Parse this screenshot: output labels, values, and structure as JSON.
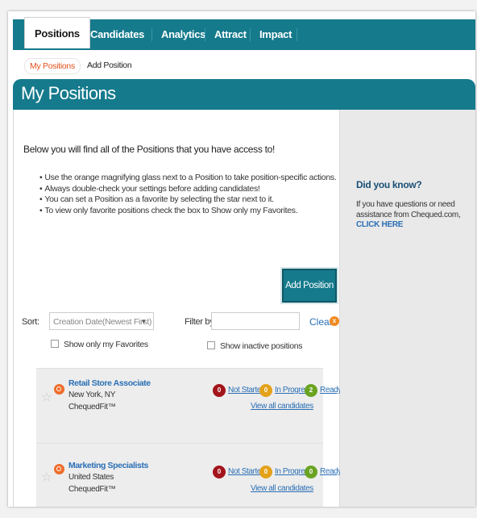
{
  "nav": {
    "tabs": [
      {
        "label": "Positions",
        "active": true
      },
      {
        "label": "Candidates"
      },
      {
        "label": "Analytics"
      },
      {
        "label": "Attract"
      },
      {
        "label": "Impact"
      }
    ]
  },
  "subnav": {
    "items": [
      {
        "label": "My Positions",
        "active": true
      },
      {
        "label": "Add Position"
      }
    ]
  },
  "page": {
    "title": "My Positions",
    "intro": "Below you will find all of the Positions that you have access to!",
    "bullets": [
      "Use the orange magnifying glass next to a Position to take position-specific actions.",
      "Always double-check your settings before adding candidates!",
      "You can set a Position as a favorite by selecting the star next to it.",
      "To view only favorite positions check the box to Show only my Favorites."
    ],
    "add_button": "Add Position"
  },
  "filters": {
    "sort_label": "Sort:",
    "sort_value": "Creation Date(Newest First)",
    "filter_label": "Filter by:",
    "filter_value": "",
    "clear_label": "Clear",
    "clear_badge": "x",
    "favorites_label": "Show only my Favorites",
    "inactive_label": "Show inactive positions"
  },
  "positions": [
    {
      "title": "Retail Store Associate",
      "location": "New York, NY",
      "product": "ChequedFit™",
      "not_started_count": "0",
      "not_started_label": "Not Started",
      "in_progress_count": "0",
      "in_progress_label": "In Progress",
      "ready_count": "2",
      "ready_label": "Ready",
      "view_all": "View all candidates"
    },
    {
      "title": "Marketing Specialists",
      "location": "United States",
      "product": "ChequedFit™",
      "not_started_count": "0",
      "not_started_label": "Not Started",
      "in_progress_count": "0",
      "in_progress_label": "In Progress",
      "ready_count": "0",
      "ready_label": "Ready",
      "view_all": "View all candidates"
    }
  ],
  "sidebar": {
    "title": "Did you know?",
    "text": "If you have questions or need assistance from Chequed.com,",
    "link": "CLICK HERE"
  },
  "colors": {
    "brand_teal": "#157a8c",
    "accent_orange": "#e1521d",
    "not_started": "#a3141b",
    "in_progress": "#e3a21a",
    "ready": "#6aa321"
  },
  "icons": [
    "star-icon",
    "magnifier-icon",
    "info-dot-icon",
    "dropdown-caret-icon"
  ]
}
